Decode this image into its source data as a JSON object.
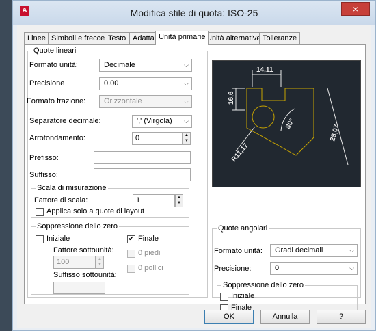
{
  "window": {
    "title": "Modifica stile di quota: ISO-25",
    "close_glyph": "×",
    "app_icon_letter": "A"
  },
  "tabs": [
    {
      "label": "Linee",
      "active": false
    },
    {
      "label": "Simboli e frecce",
      "active": false
    },
    {
      "label": "Testo",
      "active": false
    },
    {
      "label": "Adatta",
      "active": false
    },
    {
      "label": "Unità primarie",
      "active": true
    },
    {
      "label": "Unità alternative",
      "active": false
    },
    {
      "label": "Tolleranze",
      "active": false
    }
  ],
  "linear": {
    "title": "Quote lineari",
    "unit_format_label": "Formato unità:",
    "unit_format_value": "Decimale",
    "precision_label": "Precisione",
    "precision_value": "0.00",
    "fraction_format_label": "Formato frazione:",
    "fraction_format_value": "Orizzontale",
    "decimal_sep_label": "Separatore decimale:",
    "decimal_sep_value": "',' (Virgola)",
    "rounding_label": "Arrotondamento:",
    "rounding_value": "0",
    "prefix_label": "Prefisso:",
    "prefix_value": "",
    "suffix_label": "Suffisso:",
    "suffix_value": ""
  },
  "scale": {
    "title": "Scala di misurazione",
    "factor_label": "Fattore di scala:",
    "factor_value": "1",
    "layout_only_label": "Applica solo a quote di layout",
    "layout_only_checked": false
  },
  "zero_supp": {
    "title": "Soppressione dello zero",
    "leading_label": "Iniziale",
    "leading_checked": false,
    "trailing_label": "Finale",
    "trailing_checked": true,
    "subunit_factor_label": "Fattore sottounità:",
    "subunit_factor_value": "100",
    "subunit_suffix_label": "Suffisso sottounità:",
    "subunit_suffix_value": "",
    "feet_label": "0 piedi",
    "inches_label": "0 pollici"
  },
  "angular": {
    "title": "Quote angolari",
    "unit_format_label": "Formato unità:",
    "unit_format_value": "Gradi decimali",
    "precision_label": "Precisione:",
    "precision_value": "0",
    "zero_title": "Soppressione dello zero",
    "leading_label": "Iniziale",
    "leading_checked": false,
    "trailing_label": "Finale",
    "trailing_checked": false
  },
  "preview": {
    "dim_top": "14,11",
    "dim_left": "16,6",
    "dim_right": "28,07",
    "dim_angle": "80°",
    "dim_radius": "R11,17",
    "colors": {
      "background": "#212830",
      "geometry": "#c8a400",
      "dimension": "#e8e8e8"
    }
  },
  "buttons": {
    "ok": "OK",
    "cancel": "Annulla",
    "help": "?"
  },
  "chev": "⌵",
  "check": "✔",
  "spin_up": "▲",
  "spin_down": "▼"
}
